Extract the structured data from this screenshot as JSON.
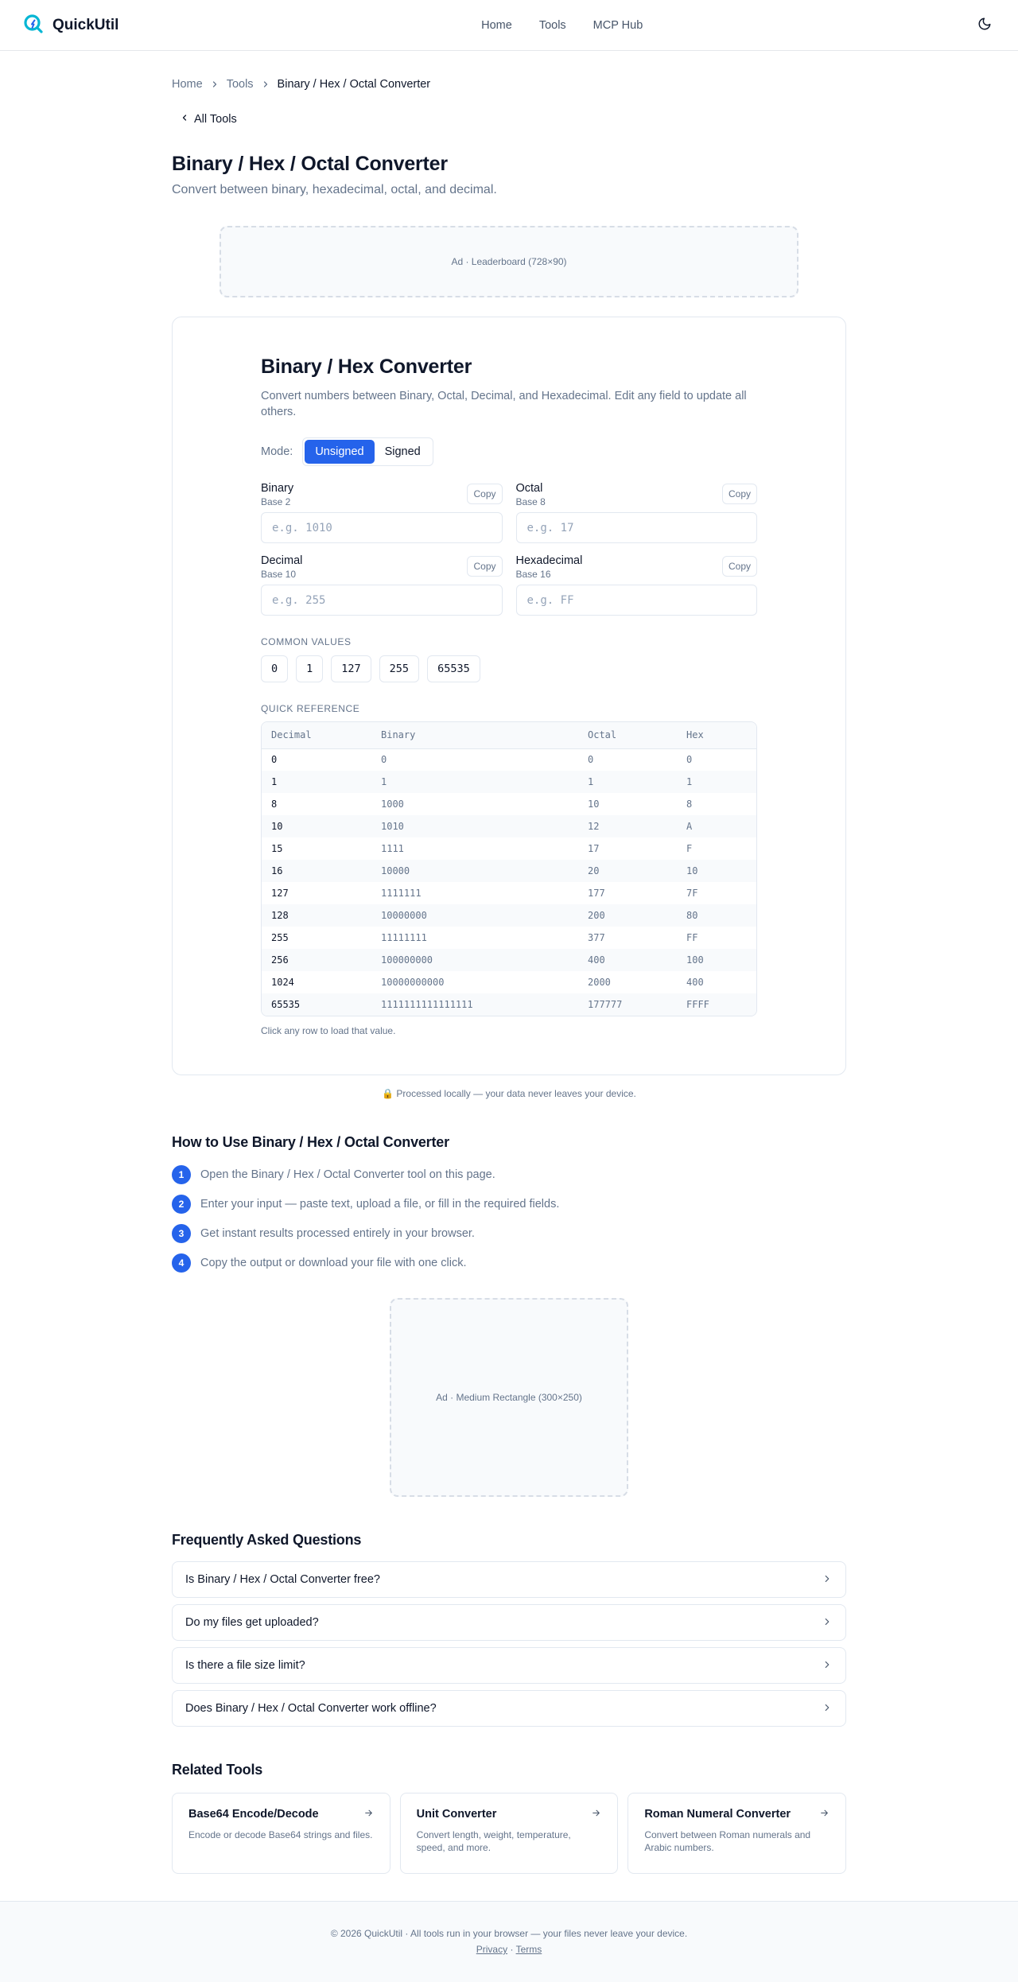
{
  "header": {
    "brand": "QuickUtil",
    "nav": [
      "Home",
      "Tools",
      "MCP Hub"
    ],
    "accent": "#2563eb",
    "logo_color": "#06b6d4"
  },
  "breadcrumb": {
    "home": "Home",
    "tools": "Tools",
    "current": "Binary / Hex / Octal Converter"
  },
  "back_link": "All Tools",
  "page": {
    "title": "Binary / Hex / Octal Converter",
    "subtitle": "Convert between binary, hexadecimal, octal, and decimal."
  },
  "ads": {
    "leaderboard": "Ad · Leaderboard (728×90)",
    "medium_rect": "Ad · Medium Rectangle (300×250)"
  },
  "tool": {
    "title": "Binary / Hex Converter",
    "description": "Convert numbers between Binary, Octal, Decimal, and Hexadecimal. Edit any field to update all others.",
    "mode_label": "Mode:",
    "modes": [
      "Unsigned",
      "Signed"
    ],
    "active_mode": "Unsigned",
    "copy_label": "Copy",
    "fields": {
      "binary": {
        "label": "Binary",
        "base": "Base 2",
        "placeholder": "e.g. 1010",
        "value": ""
      },
      "octal": {
        "label": "Octal",
        "base": "Base 8",
        "placeholder": "e.g. 17",
        "value": ""
      },
      "decimal": {
        "label": "Decimal",
        "base": "Base 10",
        "placeholder": "e.g. 255",
        "value": ""
      },
      "hex": {
        "label": "Hexadecimal",
        "base": "Base 16",
        "placeholder": "e.g. FF",
        "value": ""
      }
    },
    "common_label": "COMMON VALUES",
    "common_values": [
      "0",
      "1",
      "127",
      "255",
      "65535"
    ],
    "reference_label": "QUICK REFERENCE",
    "reference_headers": [
      "Decimal",
      "Binary",
      "Octal",
      "Hex"
    ],
    "reference_rows": [
      [
        "0",
        "0",
        "0",
        "0"
      ],
      [
        "1",
        "1",
        "1",
        "1"
      ],
      [
        "8",
        "1000",
        "10",
        "8"
      ],
      [
        "10",
        "1010",
        "12",
        "A"
      ],
      [
        "15",
        "1111",
        "17",
        "F"
      ],
      [
        "16",
        "10000",
        "20",
        "10"
      ],
      [
        "127",
        "1111111",
        "177",
        "7F"
      ],
      [
        "128",
        "10000000",
        "200",
        "80"
      ],
      [
        "255",
        "11111111",
        "377",
        "FF"
      ],
      [
        "256",
        "100000000",
        "400",
        "100"
      ],
      [
        "1024",
        "10000000000",
        "2000",
        "400"
      ],
      [
        "65535",
        "1111111111111111",
        "177777",
        "FFFF"
      ]
    ],
    "hint": "Click any row to load that value."
  },
  "privacy_note": "Processed locally — your data never leaves your device.",
  "howto": {
    "title": "How to Use Binary / Hex / Octal Converter",
    "steps": [
      "Open the Binary / Hex / Octal Converter tool on this page.",
      "Enter your input — paste text, upload a file, or fill in the required fields.",
      "Get instant results processed entirely in your browser.",
      "Copy the output or download your file with one click."
    ]
  },
  "faq": {
    "title": "Frequently Asked Questions",
    "items": [
      "Is Binary / Hex / Octal Converter free?",
      "Do my files get uploaded?",
      "Is there a file size limit?",
      "Does Binary / Hex / Octal Converter work offline?"
    ]
  },
  "related": {
    "title": "Related Tools",
    "items": [
      {
        "name": "Base64 Encode/Decode",
        "desc": "Encode or decode Base64 strings and files."
      },
      {
        "name": "Unit Converter",
        "desc": "Convert length, weight, temperature, speed, and more."
      },
      {
        "name": "Roman Numeral Converter",
        "desc": "Convert between Roman numerals and Arabic numbers."
      }
    ]
  },
  "footer": {
    "text": "© 2026 QuickUtil · All tools run in your browser — your files never leave your device.",
    "privacy": "Privacy",
    "separator": "·",
    "terms": "Terms"
  }
}
